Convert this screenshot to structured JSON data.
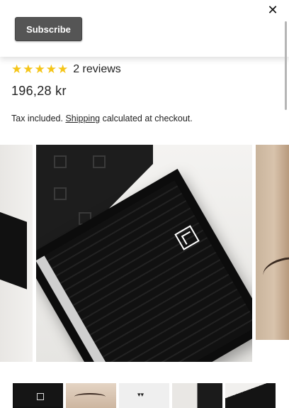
{
  "popup": {
    "subscribe_label": "Subscribe",
    "close_glyph": "✕"
  },
  "product": {
    "stars": "★★★★★",
    "rating": 5,
    "reviews_label": "2 reviews",
    "price": "196,28 kr",
    "tax_prefix": "Tax included.",
    "shipping_link": "Shipping",
    "tax_suffix": "calculated at checkout."
  },
  "carousel": {
    "main_logo_icon": "fj-logo-icon"
  },
  "thumbnails": [
    {
      "name": "thumb-lash-box-closeup",
      "active": true
    },
    {
      "name": "thumb-eye-lashes"
    },
    {
      "name": "thumb-lash-tweezers"
    },
    {
      "name": "thumb-lash-box-open"
    },
    {
      "name": "thumb-lash-box-angle"
    }
  ],
  "colors": {
    "star": "#f5c518",
    "subscribe_bg": "#555555"
  }
}
